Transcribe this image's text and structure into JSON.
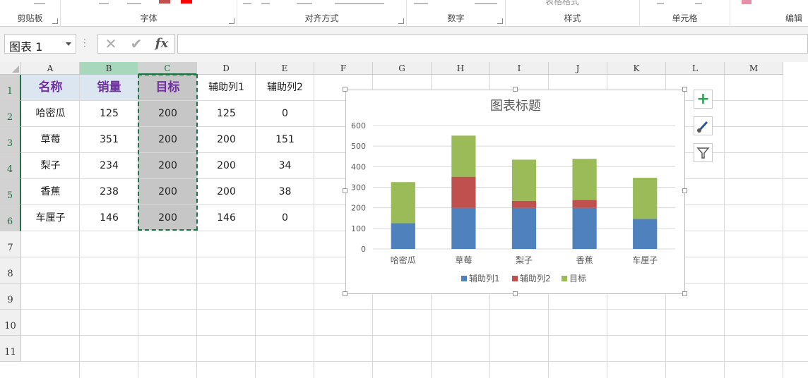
{
  "ribbon": {
    "groups": [
      {
        "label": "剪贴板"
      },
      {
        "label": "字体"
      },
      {
        "label": "对齐方式"
      },
      {
        "label": "数字"
      },
      {
        "label": "样式"
      },
      {
        "label": "单元格"
      },
      {
        "label": "编辑"
      }
    ],
    "style_hint": "表格格式"
  },
  "formula_bar": {
    "name_box": "图表 1",
    "cancel_icon": "✕",
    "enter_icon": "✔",
    "fx_label": "fx",
    "formula": ""
  },
  "sheet": {
    "columns": [
      "A",
      "B",
      "C",
      "D",
      "E",
      "F",
      "G",
      "H",
      "I",
      "J",
      "K",
      "L",
      "M"
    ],
    "rows": [
      "1",
      "2",
      "3",
      "4",
      "5",
      "6",
      "7",
      "8",
      "9",
      "10",
      "11"
    ],
    "selected_column": "C",
    "header": {
      "A": "名称",
      "B": "销量",
      "C": "目标",
      "D": "辅助列1",
      "E": "辅助列2"
    },
    "data": [
      {
        "A": "哈密瓜",
        "B": "125",
        "C": "200",
        "D": "125",
        "E": "0"
      },
      {
        "A": "草莓",
        "B": "351",
        "C": "200",
        "D": "200",
        "E": "151"
      },
      {
        "A": "梨子",
        "B": "234",
        "C": "200",
        "D": "200",
        "E": "34"
      },
      {
        "A": "香蕉",
        "B": "238",
        "C": "200",
        "D": "200",
        "E": "38"
      },
      {
        "A": "车厘子",
        "B": "146",
        "C": "200",
        "D": "146",
        "E": "0"
      }
    ]
  },
  "chart_data": {
    "type": "bar",
    "stacked": true,
    "title": "图表标题",
    "categories": [
      "哈密瓜",
      "草莓",
      "梨子",
      "香蕉",
      "车厘子"
    ],
    "series": [
      {
        "name": "辅助列1",
        "color": "#4f81bd",
        "values": [
          125,
          200,
          200,
          200,
          146
        ]
      },
      {
        "name": "辅助列2",
        "color": "#c0504d",
        "values": [
          0,
          151,
          34,
          38,
          0
        ]
      },
      {
        "name": "目标",
        "color": "#9bbb59",
        "values": [
          200,
          200,
          200,
          200,
          200
        ]
      }
    ],
    "ylim": [
      0,
      600
    ],
    "yticks": [
      "0",
      "100",
      "200",
      "300",
      "400",
      "500",
      "600"
    ],
    "grid": true,
    "legend": "bottom"
  },
  "chart_side_buttons": [
    "chart-elements",
    "chart-styles",
    "chart-filters"
  ]
}
